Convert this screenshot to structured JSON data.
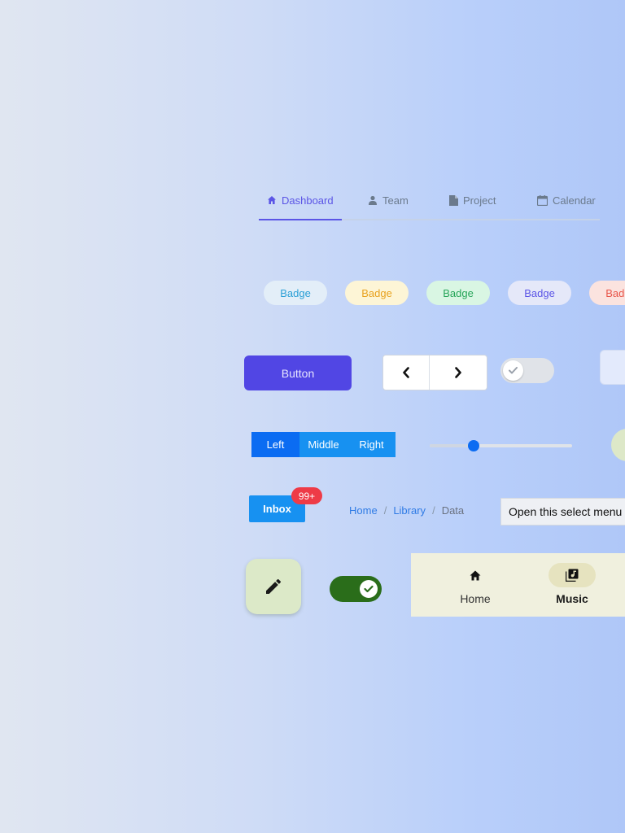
{
  "tabs": {
    "items": [
      {
        "label": "Dashboard",
        "icon": "home-icon",
        "active": true
      },
      {
        "label": "Team",
        "icon": "user-icon",
        "active": false
      },
      {
        "label": "Project",
        "icon": "file-icon",
        "active": false
      },
      {
        "label": "Calendar",
        "icon": "calendar-icon",
        "active": false
      }
    ]
  },
  "badges": [
    {
      "label": "Badge",
      "color": "#2a9fd6",
      "bg": "#e3eef8"
    },
    {
      "label": "Badge",
      "color": "#e8a21f",
      "bg": "#fdf5d6"
    },
    {
      "label": "Badge",
      "color": "#27a559",
      "bg": "#d9f6e3"
    },
    {
      "label": "Badge",
      "color": "#5b55e6",
      "bg": "#e5e8f9"
    },
    {
      "label": "Badge",
      "color": "#e8564a",
      "bg": "#fbe3df"
    }
  ],
  "primary_button": {
    "label": "Button",
    "color": "#5146e4"
  },
  "pager": {
    "prev_icon": "chevron-left-icon",
    "next_icon": "chevron-right-icon"
  },
  "toggle_off": {
    "checked": false
  },
  "segmented": {
    "items": [
      "Left",
      "Middle",
      "Right"
    ],
    "selected": "Left"
  },
  "slider": {
    "value": 0.31
  },
  "inbox": {
    "label": "Inbox",
    "count": "99+"
  },
  "breadcrumb": {
    "items": [
      "Home",
      "Library",
      "Data"
    ],
    "separator": "/"
  },
  "select_menu": {
    "placeholder": "Open this select menu"
  },
  "fab": {
    "icon": "pencil-icon"
  },
  "toggle_on": {
    "checked": true
  },
  "bottom_nav": {
    "items": [
      {
        "label": "Home",
        "icon": "home-icon",
        "active": false
      },
      {
        "label": "Music",
        "icon": "library-music-icon",
        "active": true
      }
    ]
  },
  "colors": {
    "accent": "#5b55e6",
    "primary_blue": "#0b6cf2",
    "danger": "#ee3b47",
    "success": "#2a6d1a"
  }
}
